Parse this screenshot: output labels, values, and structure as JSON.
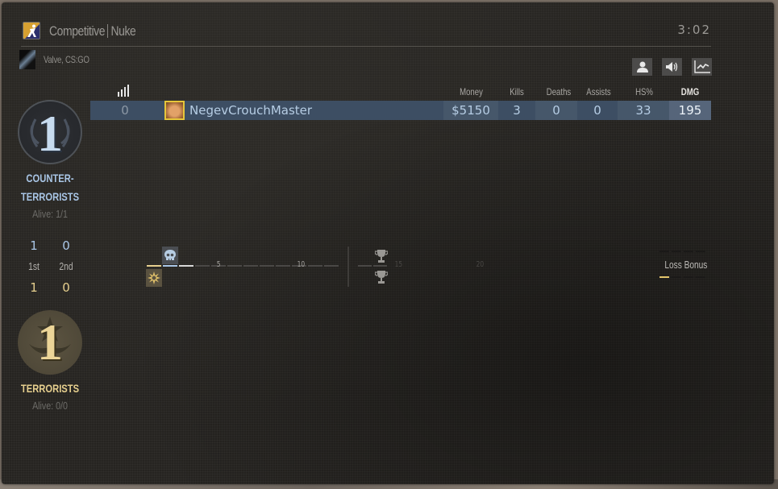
{
  "header": {
    "mode": "Competitive",
    "map": "Nuke",
    "timer": "3:02",
    "server": "Valve, CS:GO",
    "mode_icon": "csgo-competitive-icon",
    "tools": [
      {
        "name": "player-profile-button",
        "icon": "person-icon"
      },
      {
        "name": "mute-button",
        "icon": "speaker-icon"
      },
      {
        "name": "stats-button",
        "icon": "line-chart-icon"
      }
    ]
  },
  "scoreboard": {
    "columns": {
      "ping": "ping-bars-icon",
      "money": "Money",
      "kills": "Kills",
      "deaths": "Deaths",
      "assists": "Assists",
      "hs": "HS%",
      "dmg": "DMG"
    },
    "players": [
      {
        "rank": "0",
        "name": "NegevCrouchMaster",
        "money": "$5150",
        "kills": "3",
        "deaths": "0",
        "assists": "0",
        "hs": "33",
        "dmg": "195",
        "avatar_border_color": "#e6c63a"
      }
    ]
  },
  "teams": {
    "ct": {
      "score": "1",
      "name_line1": "COUNTER-",
      "name_line2": "TERRORISTS",
      "alive": "Alive: 1/1",
      "first_half": "1",
      "second_half": "0",
      "color": "#a9c6e6"
    },
    "t": {
      "score": "1",
      "name": "TERRORISTS",
      "alive": "Alive: 0/0",
      "first_half": "1",
      "second_half": "0",
      "color": "#e6cf8e"
    },
    "half_labels": [
      "1st",
      "2nd"
    ]
  },
  "timeline": {
    "rounds": [
      {
        "round": 1,
        "winner": "t",
        "icon": "bomb-explosion-icon"
      },
      {
        "round": 2,
        "winner": "ct",
        "icon": "skull-icon"
      }
    ],
    "current_round": 3,
    "tick_labels": [
      "5",
      "10",
      "15",
      "20"
    ],
    "halftime_icons": [
      "trophy-icon",
      "trophy-icon"
    ]
  },
  "loss_bonus": {
    "label": "Loss Bonus",
    "ct_level": 0,
    "t_level": 1,
    "max_level": 4
  }
}
